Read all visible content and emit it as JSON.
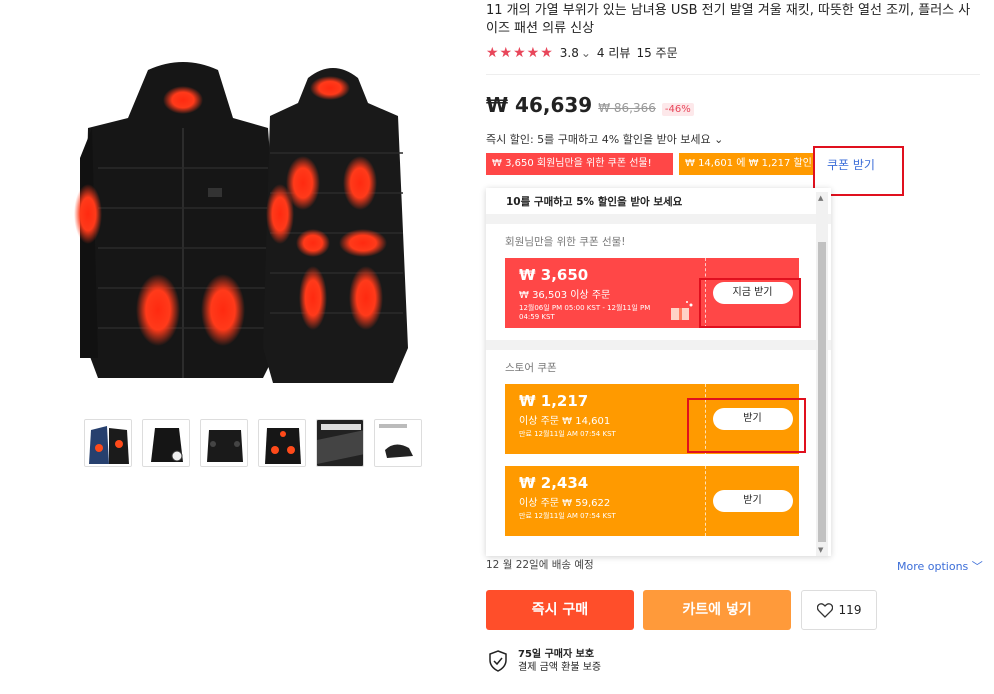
{
  "product": {
    "title": "11 개의 가열 부위가 있는 남녀용 USB 전기 발열 겨울 재킷, 따뜻한 열선 조끼, 플러스 사이즈 패션 의류 신상",
    "rating_value": "3.8",
    "rating_chevron": "⌄",
    "reviews": "4 리뷰",
    "orders": "15 주문",
    "stars": "★★★★★"
  },
  "price": {
    "current": "₩ 46,639",
    "original": "₩ 86,366",
    "discount": "-46%"
  },
  "instant_discount": "즉시 할인: 5를 구매하고 4% 할인을 받아 보세요 ⌄",
  "coupon_strip": {
    "chip_red": "₩ 3,650 회원님만을 위한 쿠폰 선물!",
    "chip_orange": "₩ 14,601 에 ₩ 1,217 할인",
    "get_coupon": "쿠폰 받기"
  },
  "panel": {
    "top_text": "10를 구매하고 5% 할인을 받아 보세요",
    "member_section_title": "회원님만을 위한 쿠폰 선물!",
    "store_section_title": "스토어 쿠폰",
    "coupons": [
      {
        "amount": "₩ 3,650",
        "condition": "₩ 36,503 이상 주문",
        "validity": "12월06일 PM 05:00 KST - 12월11일 PM 04:59 KST",
        "button": "지금 받기"
      },
      {
        "amount": "₩ 1,217",
        "condition": "이상 주문 ₩ 14,601",
        "validity": "만료 12월11일 AM 07:54 KST",
        "button": "받기"
      },
      {
        "amount": "₩ 2,434",
        "condition": "이상 주문 ₩ 59,622",
        "validity": "만료 12월11일 AM 07:54 KST",
        "button": "받기"
      }
    ]
  },
  "delivery": "12 월 22일에 배송 예정",
  "more_options": "More options ﹀",
  "buttons": {
    "buy_now": "즉시 구매",
    "add_cart": "카트에 넣기",
    "wishlist_count": "119"
  },
  "protection": {
    "title": "75일 구매자 보호",
    "subtitle": "결제 금액 환불 보증"
  },
  "colors": {
    "accent_red": "#ff4747",
    "accent_orange": "#ff9a00",
    "link_blue": "#3b6dd8",
    "annotation_red": "#e0101e"
  },
  "icons": [
    "heart-icon",
    "shield-check-icon",
    "gift-icon",
    "scroll-up-icon",
    "scroll-down-icon"
  ]
}
